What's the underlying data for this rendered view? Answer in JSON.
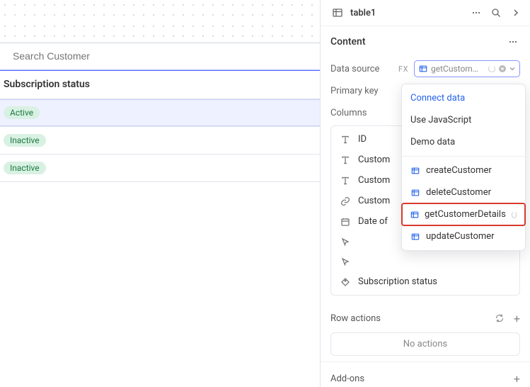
{
  "search": {
    "placeholder": "Search Customer"
  },
  "table": {
    "column_header": "Subscription status",
    "rows": [
      {
        "status": "Active",
        "selected": true
      },
      {
        "status": "Inactive",
        "selected": false
      },
      {
        "status": "Inactive",
        "selected": false
      }
    ]
  },
  "panel": {
    "title": "table1",
    "content_heading": "Content",
    "data_source": {
      "label": "Data source",
      "fx": "FX",
      "value_display": "getCustom…"
    },
    "primary_key": {
      "label": "Primary key"
    },
    "columns_label": "Columns",
    "columns": [
      {
        "icon": "text",
        "label": "ID"
      },
      {
        "icon": "text",
        "label": "Custom"
      },
      {
        "icon": "text",
        "label": "Custom"
      },
      {
        "icon": "link",
        "label": "Custom"
      },
      {
        "icon": "calendar",
        "label": "Date of"
      },
      {
        "icon": "cursor",
        "label": ""
      },
      {
        "icon": "cursor",
        "label": ""
      },
      {
        "icon": "tag",
        "label": "Subscription status"
      }
    ],
    "row_actions": {
      "label": "Row actions",
      "empty": "No actions"
    },
    "addons": {
      "label": "Add-ons"
    }
  },
  "dropdown": {
    "connect_data": "Connect data",
    "use_js": "Use JavaScript",
    "demo": "Demo data",
    "items": [
      {
        "label": "createCustomer",
        "highlight": false
      },
      {
        "label": "deleteCustomer",
        "highlight": false
      },
      {
        "label": "getCustomerDetails",
        "highlight": true,
        "loading": true
      },
      {
        "label": "updateCustomer",
        "highlight": false
      }
    ]
  }
}
